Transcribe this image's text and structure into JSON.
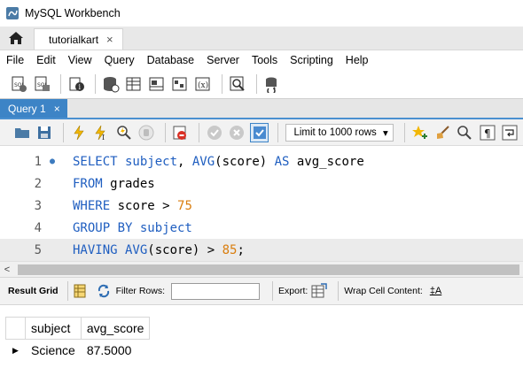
{
  "app": {
    "title": "MySQL Workbench"
  },
  "connection_tab": {
    "label": "tutorialkart",
    "close": "×"
  },
  "menu": [
    "File",
    "Edit",
    "View",
    "Query",
    "Database",
    "Server",
    "Tools",
    "Scripting",
    "Help"
  ],
  "query_tab": {
    "label": "Query 1",
    "close": "×"
  },
  "editor_toolbar": {
    "limit_label": "Limit to 1000 rows",
    "limit_caret": "▾"
  },
  "editor": {
    "lines": [
      {
        "n": "1",
        "marker": "●"
      },
      {
        "n": "2",
        "marker": ""
      },
      {
        "n": "3",
        "marker": ""
      },
      {
        "n": "4",
        "marker": ""
      },
      {
        "n": "5",
        "marker": ""
      }
    ]
  },
  "hscroll": {
    "left_arrow": "<"
  },
  "result_toolbar": {
    "result_grid": "Result Grid",
    "filter_rows": "Filter Rows:",
    "export": "Export:",
    "wrap": "Wrap Cell Content:",
    "wrap_icon": "‡A"
  },
  "results": {
    "columns": [
      "subject",
      "avg_score"
    ],
    "rows": [
      [
        "Science",
        "87.5000"
      ]
    ],
    "row_indicator": "▶"
  },
  "colors": {
    "accent": "#3d84c6",
    "keyword": "#1f5ec0",
    "number": "#d97d0d"
  }
}
